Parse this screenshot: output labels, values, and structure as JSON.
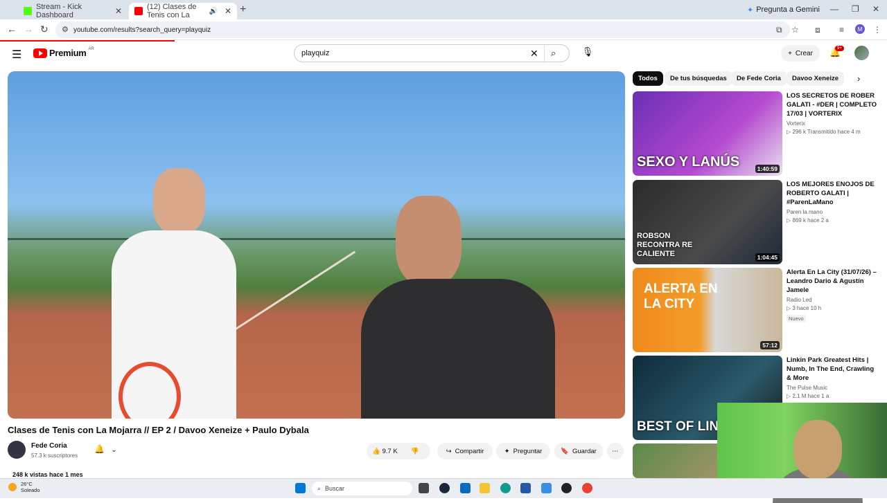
{
  "browser": {
    "tabs": [
      {
        "title": "Stream - Kick Dashboard",
        "favicon_color": "#53fc18"
      },
      {
        "title": "(12) Clases de Tenis con La",
        "favicon_color": "#ff0000",
        "active": true
      }
    ],
    "gemini_label": "Pregunta a Gemini",
    "url": "youtube.com/results?search_query=playquiz",
    "profile_initial": "M"
  },
  "youtube": {
    "logo_text": "Premium",
    "logo_region": "AR",
    "search_value": "playquiz",
    "create_label": "Crear",
    "notification_count": "9+"
  },
  "video": {
    "title": "Clases de Tenis con La Mojarra // EP 2 / Davoo Xeneize + Paulo Dybala",
    "channel": "Fede Coria",
    "subscribers": "57.3 k suscriptores",
    "likes": "9.7 K",
    "share_label": "Compartir",
    "ask_label": "Preguntar",
    "save_label": "Guardar",
    "views_line": "248 k vistas  hace 1 mes"
  },
  "chips": [
    "Todos",
    "De tus búsquedas",
    "De Fede Coria",
    "Davoo Xeneize"
  ],
  "recommendations": [
    {
      "title": "LOS SECRETOS DE ROBER GALATI - #DER | COMPLETO 17/03 | VORTERIX",
      "channel": "Vorterix",
      "meta": "▷ 296 k  Transmitido hace 4 m",
      "duration": "1:40:59",
      "thumb_text": "SEXO Y LANÚS",
      "badge": ""
    },
    {
      "title": "LOS MEJORES ENOJOS DE ROBERTO GALATI | #ParenLaMano",
      "channel": "Paren la mano",
      "meta": "▷ 869 k  hace 2 a",
      "duration": "1:04:45",
      "thumb_text": "ROBSON RECONTRA RE CALIENTE",
      "badge": ""
    },
    {
      "title": "Alerta En La City (31/07/26) – Leandro Dario & Agustín Jamele",
      "channel": "Radio Led",
      "meta": "▷ 3  hace 10 h",
      "duration": "57:12",
      "thumb_text": "ALERTA EN LA CITY",
      "badge": "Nuevo"
    },
    {
      "title": "Linkin Park Greatest Hits | Numb, In The End, Crawling & More",
      "channel": "The Pulse Music",
      "meta": "▷ 2.1 M  hace 1 a",
      "duration": "",
      "thumb_text": "BEST OF LINKIN PA",
      "badge": ""
    }
  ],
  "taskbar": {
    "temperature": "26°C",
    "weather": "Soleado",
    "search_placeholder": "Buscar"
  }
}
